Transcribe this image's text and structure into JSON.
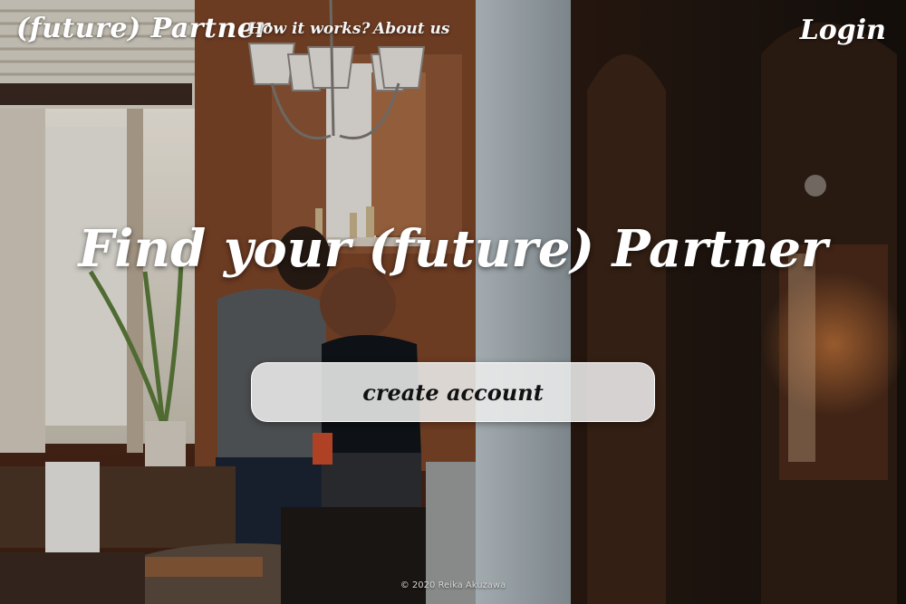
{
  "nav": {
    "brand": "(future) Partner",
    "how_it_works": "How it works?",
    "about_us": "About us",
    "login": "Login"
  },
  "hero": {
    "title": "Find your (future) Partner",
    "cta_label": "create account"
  },
  "footer": {
    "copyright": "© 2020 Reika Akuzawa"
  }
}
